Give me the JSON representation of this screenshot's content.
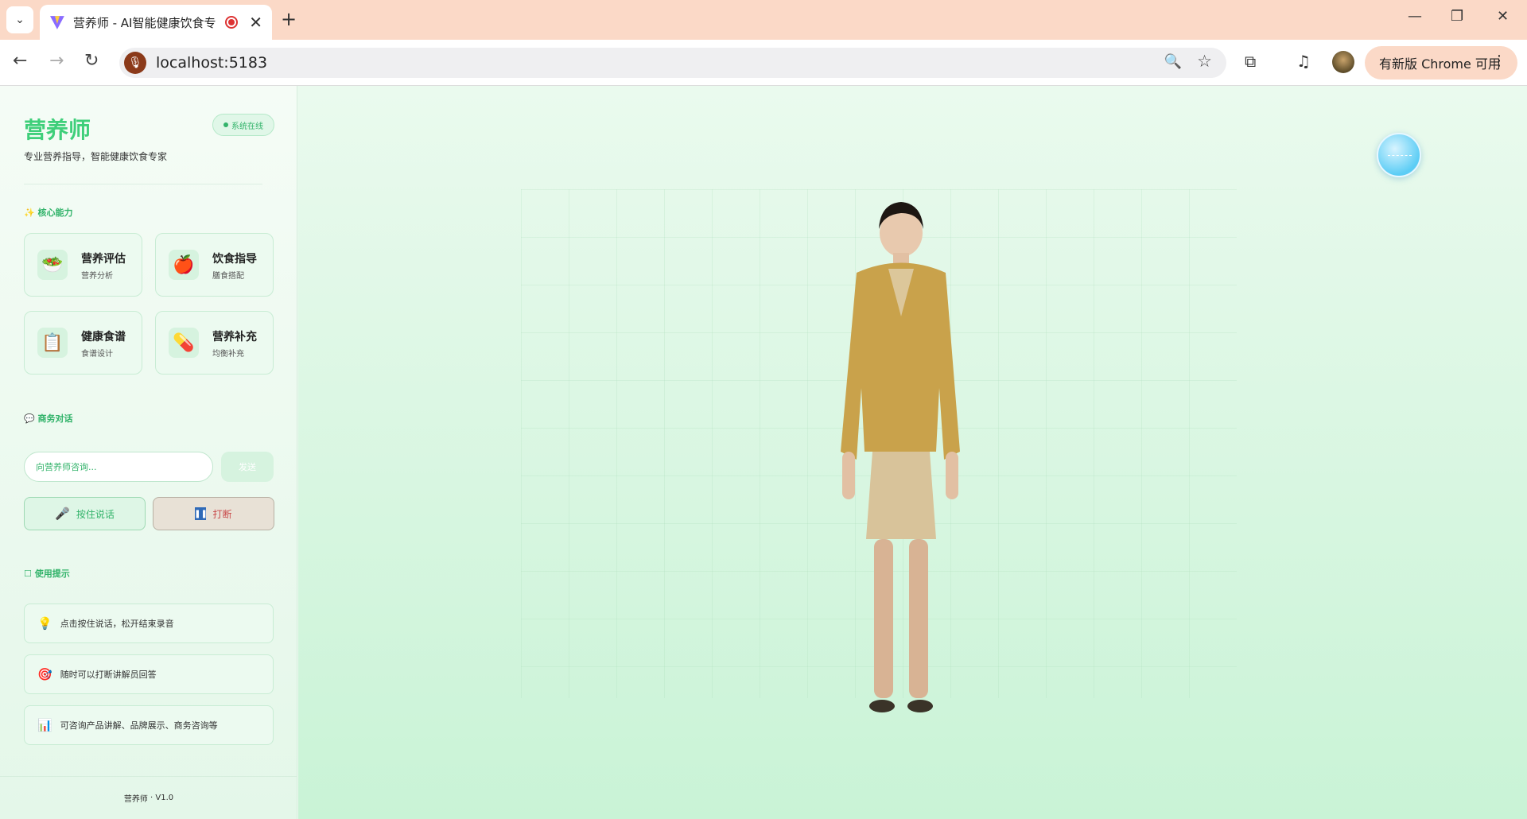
{
  "browser": {
    "tab_title": "营养师 - AI智能健康饮食专",
    "new_tab_icon": "plus-icon",
    "url": "localhost:5183",
    "update_label": "有新版 Chrome 可用"
  },
  "sidebar": {
    "brand": "营养师",
    "status": "系统在线",
    "tagline": "专业营养指导，智能健康饮食专家",
    "capabilities_title": "核心能力",
    "cards": [
      {
        "title": "营养评估",
        "sub": "营养分析",
        "icon": "salad-icon"
      },
      {
        "title": "饮食指导",
        "sub": "膳食搭配",
        "icon": "apple-icon"
      },
      {
        "title": "健康食谱",
        "sub": "食谱设计",
        "icon": "clipboard-icon"
      },
      {
        "title": "营养补充",
        "sub": "均衡补充",
        "icon": "pill-icon"
      }
    ],
    "chat_title": "商务对话",
    "chat_placeholder": "向营养师咨询...",
    "send_label": "发送",
    "talk_label": "按住说话",
    "stop_label": "打断",
    "tips_title": "使用提示",
    "tips": [
      {
        "text": "点击按住说话，松开结束录音",
        "icon": "lightbulb-icon"
      },
      {
        "text": "随时可以打断讲解员回答",
        "icon": "target-icon"
      },
      {
        "text": "可咨询产品讲解、品牌展示、商务咨询等",
        "icon": "chart-icon"
      }
    ],
    "footer_name": "营养师",
    "footer_sep": "·",
    "footer_version": "V1.0"
  },
  "colors": {
    "accent": "#3fcf7a",
    "stop": "#c94a4a"
  }
}
